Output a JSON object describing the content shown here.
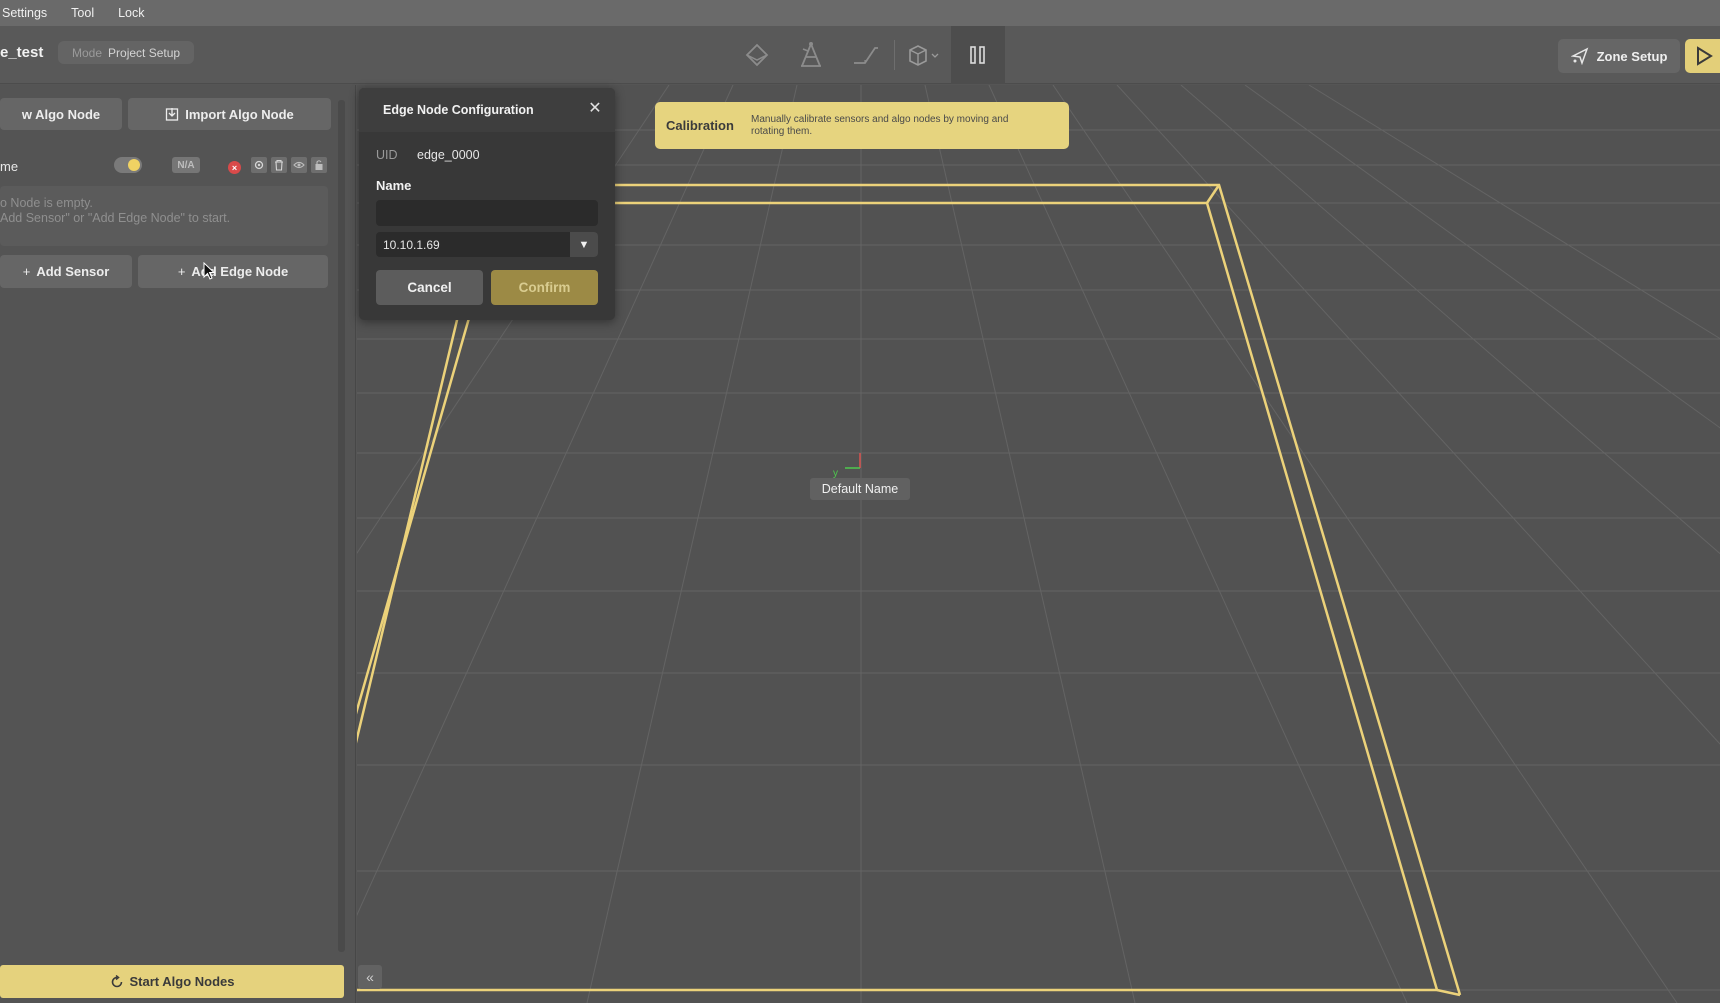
{
  "menu": {
    "items": [
      "Settings",
      "Tool",
      "Lock"
    ]
  },
  "toolbar": {
    "project_name": "e_test",
    "mode_key": "Mode",
    "mode_value": "Project Setup",
    "tools": [
      "layers-icon",
      "sensor-icon",
      "ramp-icon",
      "cube-icon",
      "pause-icon"
    ],
    "zone_setup_label": "Zone Setup"
  },
  "sidebar": {
    "new_algo_label": "w Algo Node",
    "import_algo_label": "Import Algo Node",
    "node_name": "me",
    "status_badge": "N/A",
    "empty_line1": "o Node is empty.",
    "empty_line2": "Add Sensor\" or \"Add Edge Node\" to start.",
    "add_sensor_label": "Add Sensor",
    "add_edge_label": "Add Edge Node",
    "start_label": "Start Algo Nodes"
  },
  "calibration": {
    "title": "Calibration",
    "description": "Manually calibrate sensors and algo nodes by moving and rotating them."
  },
  "dialog": {
    "title": "Edge Node Configuration",
    "close": "✕",
    "uid_label": "UID",
    "uid_value": "edge_0000",
    "name_label": "Name",
    "name_value": "",
    "ip_value": "10.10.1.69",
    "cancel_label": "Cancel",
    "confirm_label": "Confirm"
  },
  "viewport": {
    "node_label": "Default Name",
    "collapse": "«"
  },
  "colors": {
    "accent": "#e5d27d",
    "zone_outline": "#ecd27a",
    "error": "#d94a4a"
  }
}
